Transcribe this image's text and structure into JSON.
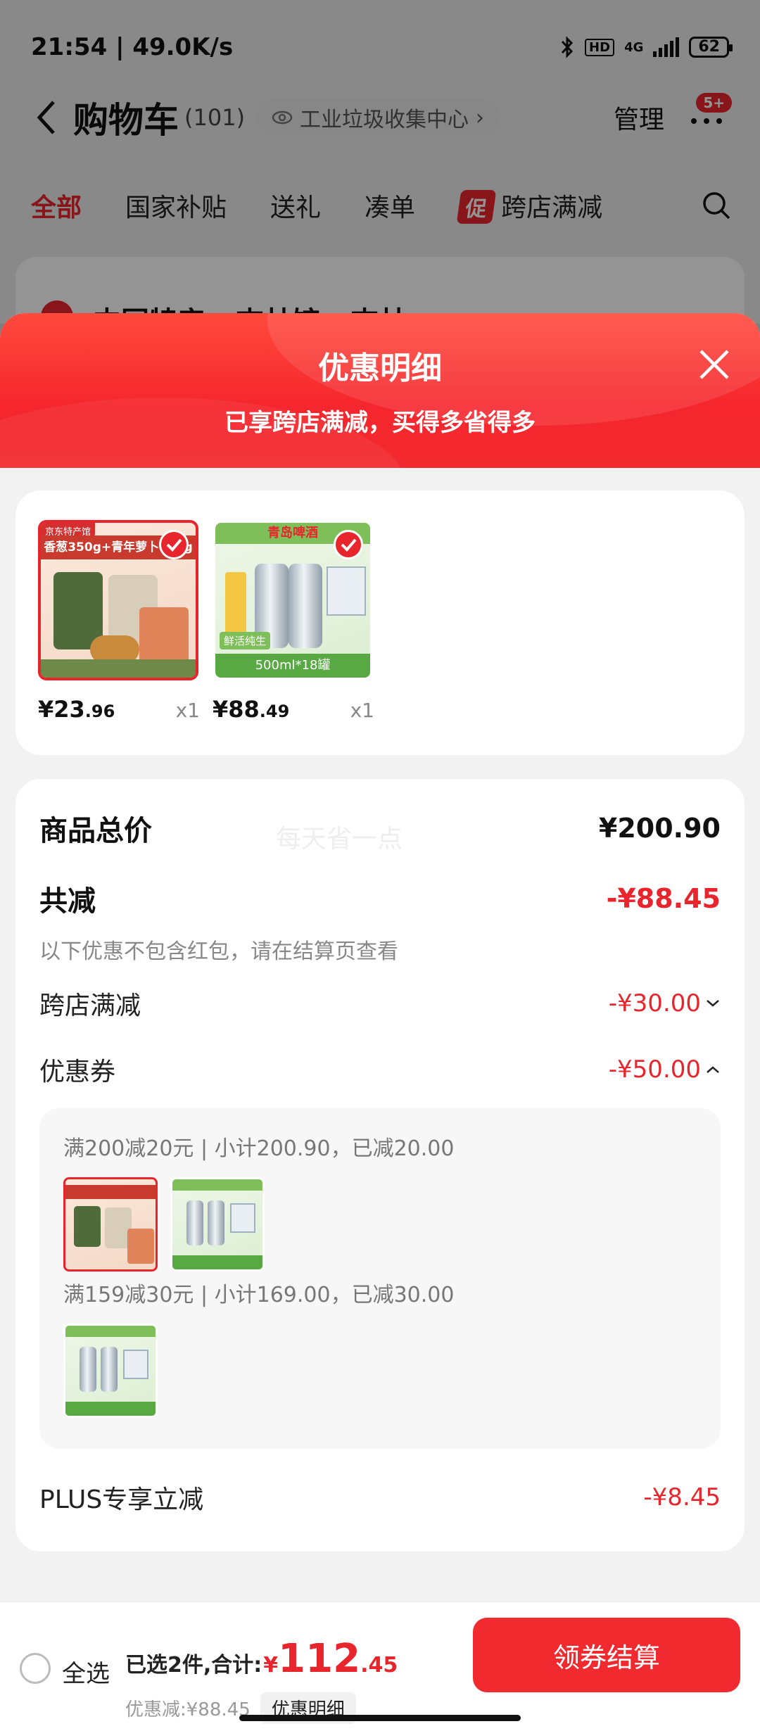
{
  "status_bar": {
    "time_speed": "21:54 | 49.0K/s",
    "hd": "HD",
    "network": "4G",
    "battery": "62"
  },
  "nav": {
    "title": "购物车",
    "count": "(101)",
    "location": "工业垃圾收集中心",
    "manage": "管理",
    "badge": "5+"
  },
  "tabs": [
    "全部",
    "国家补贴",
    "送礼",
    "凑单"
  ],
  "promo_tab": {
    "tag": "促",
    "label": "跨店满减"
  },
  "store": {
    "name": "中国特产 · 吉林馆 · 吉林 >"
  },
  "sheet": {
    "title": "优惠明细",
    "subtitle": "已享跨店满减，买得多省得多",
    "products": [
      {
        "band": "香葱350g+青年萝卜400g",
        "shop_tag": "京东特产馆",
        "price_int": "¥23",
        "price_dec": ".96",
        "qty": "x1"
      },
      {
        "band": "500ml*18罐",
        "shop_tag": "青岛啤酒",
        "side_tag": "鲜活纯生",
        "price_int": "¥88",
        "price_dec": ".49",
        "qty": "x1"
      }
    ],
    "details": {
      "total_label": "商品总价",
      "total_value": "¥200.90",
      "watermark": "每天省一点",
      "reduce_label": "共减",
      "reduce_value": "-¥88.45",
      "reduce_note": "以下优惠不包含红包，请在结算页查看",
      "cross_store_label": "跨店满减",
      "cross_store_value": "-¥30.00",
      "coupon_label": "优惠券",
      "coupon_value": "-¥50.00",
      "coupons": [
        {
          "text": "满200减20元 | 小计200.90，已减20.00"
        },
        {
          "text": "满159减30元 | 小计169.00，已减30.00"
        }
      ],
      "plus_label": "PLUS专享立减",
      "plus_value": "-¥8.45"
    }
  },
  "bottom_bar": {
    "select_all": "全选",
    "summary_prefix": "已选2件,合计:",
    "currency": "¥",
    "total_int": "112",
    "total_dec": ".45",
    "discount_text": "优惠减:¥88.45",
    "detail_button": "优惠明细",
    "checkout_button": "领券结算"
  },
  "colors": {
    "accent": "#e8252c",
    "sheet_header": "#f5262d",
    "checkout": "#f12a30"
  }
}
